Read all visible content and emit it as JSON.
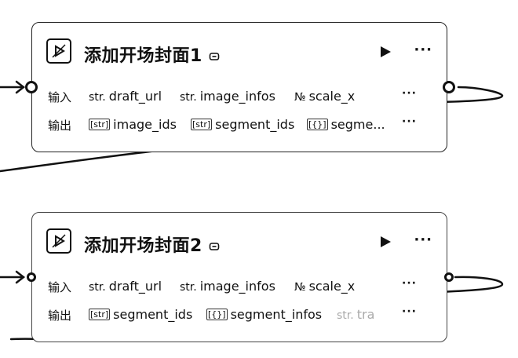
{
  "nodes": [
    {
      "title": "添加开场封面1",
      "input_label": "输入",
      "output_label": "输出",
      "inputs": [
        {
          "type": "str.",
          "name": "draft_url"
        },
        {
          "type": "str.",
          "name": "image_infos"
        },
        {
          "type": "№",
          "name": "scale_x"
        }
      ],
      "outputs": [
        {
          "type": "[str]",
          "name": "image_ids"
        },
        {
          "type": "[str]",
          "name": "segment_ids"
        },
        {
          "type": "[{}]",
          "name": "segme..."
        }
      ],
      "more": "···"
    },
    {
      "title": "添加开场封面2",
      "input_label": "输入",
      "output_label": "输出",
      "inputs": [
        {
          "type": "str.",
          "name": "draft_url"
        },
        {
          "type": "str.",
          "name": "image_infos"
        },
        {
          "type": "№",
          "name": "scale_x"
        }
      ],
      "outputs": [
        {
          "type": "[str]",
          "name": "segment_ids"
        },
        {
          "type": "[{}]",
          "name": "segment_infos"
        },
        {
          "type": "str.",
          "name": "tra"
        }
      ],
      "more": "···"
    }
  ]
}
